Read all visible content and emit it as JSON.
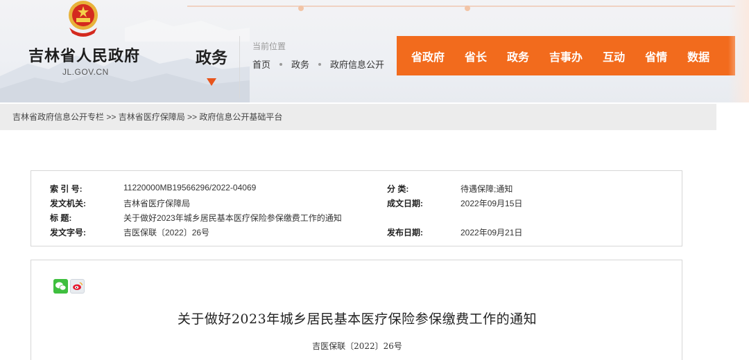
{
  "header": {
    "site_name": "吉林省人民政府",
    "site_domain": "JL.GOV.CN",
    "section_title": "政务",
    "location_label": "当前位置",
    "breadcrumbs": [
      "首页",
      "政务",
      "政府信息公开"
    ],
    "nav_items": [
      "省政府",
      "省长",
      "政务",
      "吉事办",
      "互动",
      "省情",
      "数据"
    ],
    "accent_color": "#f26b1d"
  },
  "path_bar": {
    "items": [
      "吉林省政府信息公开专栏",
      "吉林省医疗保障局",
      "政府信息公开基础平台"
    ],
    "separator": " >> "
  },
  "info": {
    "index_no_label": "索 引 号:",
    "index_no": "11220000MB19566296/2022-04069",
    "category_label": "分    类:",
    "category": "待遇保障;通知",
    "issuer_label": "发文机关:",
    "issuer": "吉林省医疗保障局",
    "created_label": "成文日期:",
    "created_date": "2022年09月15日",
    "title_label": "标    题:",
    "title": "关于做好2023年城乡居民基本医疗保险参保缴费工作的通知",
    "doc_no_label": "发文字号:",
    "doc_no": "吉医保联〔2022〕26号",
    "published_label": "发布日期:",
    "published_date": "2022年09月21日"
  },
  "article": {
    "share_icons": [
      "wechat-icon",
      "weibo-icon"
    ],
    "title": "关于做好2023年城乡居民基本医疗保险参保缴费工作的通知",
    "doc_number": "吉医保联〔2022〕26号"
  }
}
